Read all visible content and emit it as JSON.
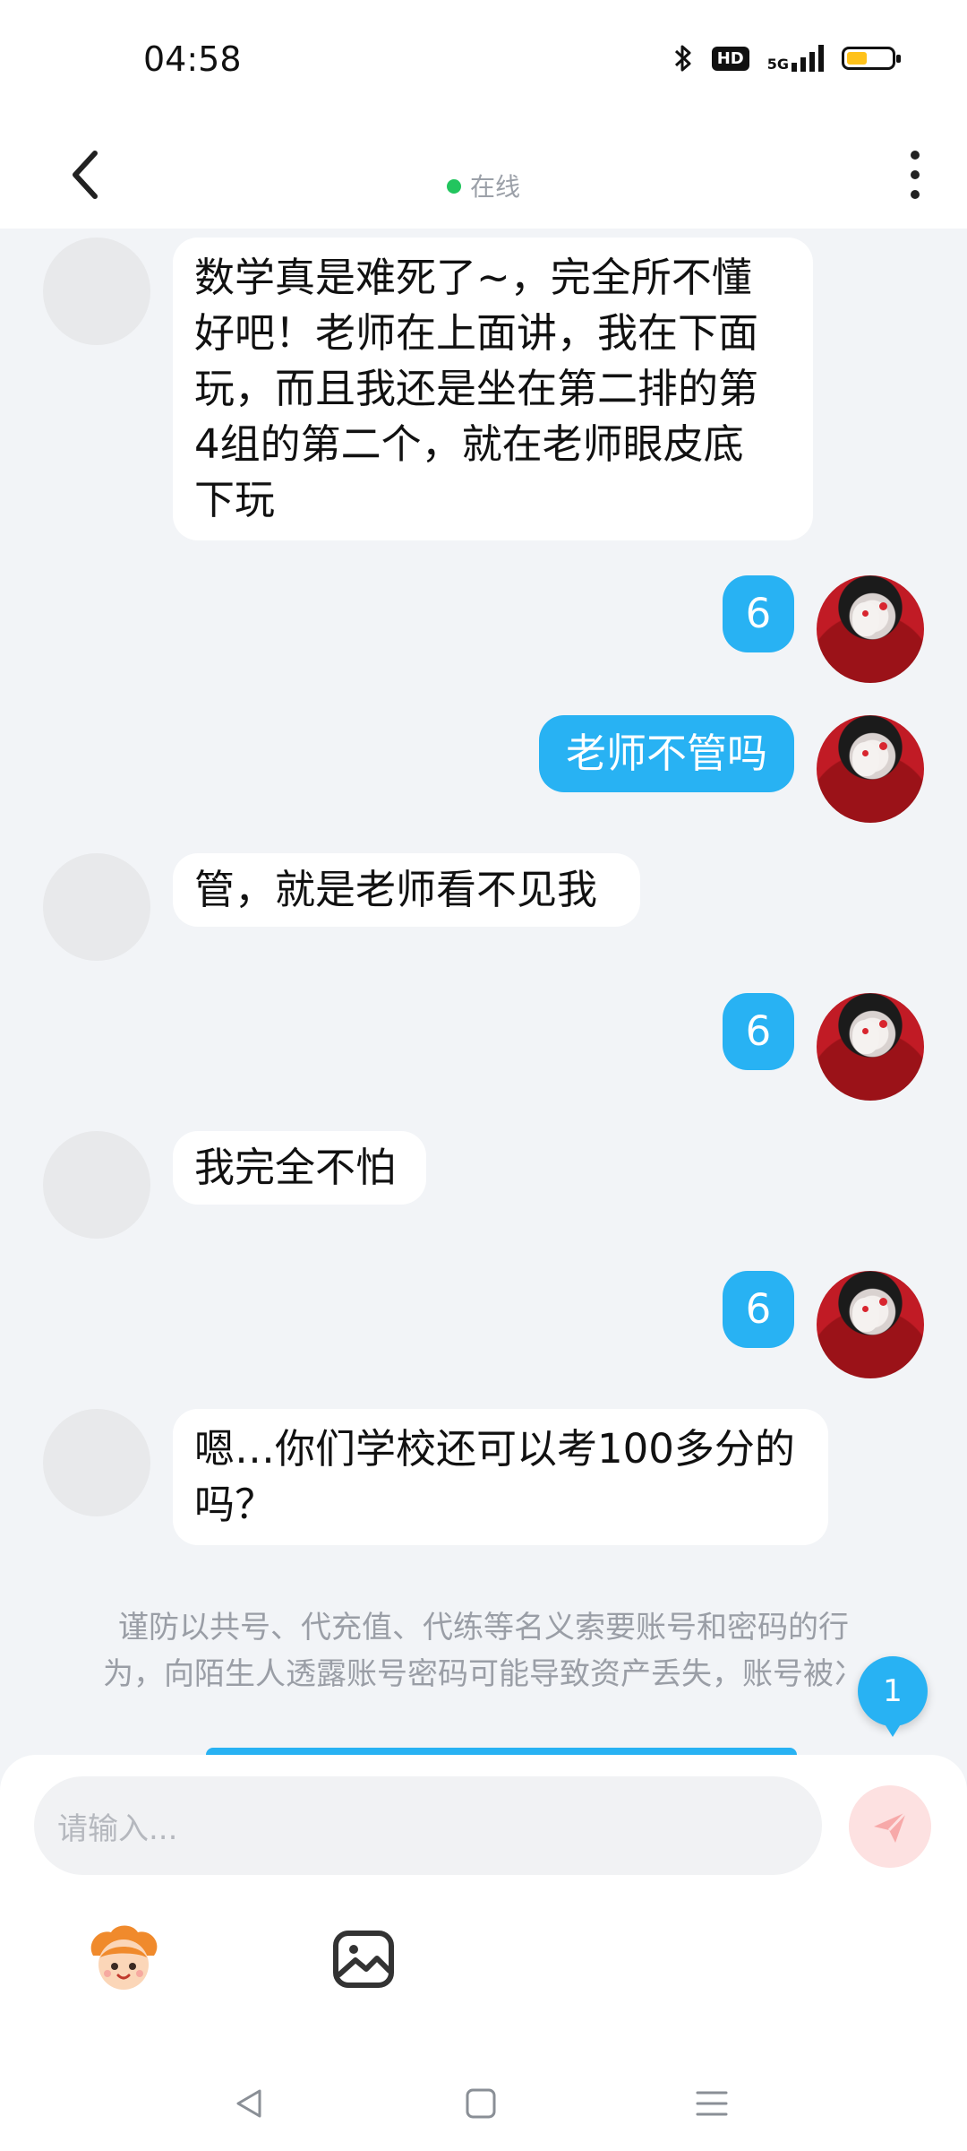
{
  "status_bar": {
    "time": "04:58",
    "hd_label": "HD",
    "network": "5G"
  },
  "header": {
    "presence": "在线"
  },
  "messages": [
    {
      "side": "left",
      "text_lines": [
        "数学真是难死了~，完全所不懂",
        "好吧！老师在上面讲，我在下面",
        "玩，而且我还是坐在第二排的第",
        "4组的第二个，就在老师眼皮底",
        "下玩"
      ]
    },
    {
      "side": "right",
      "text": "6"
    },
    {
      "side": "right",
      "text": "老师不管吗"
    },
    {
      "side": "left",
      "text_lines": [
        "管，就是老师看不见我"
      ]
    },
    {
      "side": "right",
      "text": "6"
    },
    {
      "side": "left",
      "text_lines": [
        "我完全不怕"
      ]
    },
    {
      "side": "right",
      "text": "6"
    },
    {
      "side": "left",
      "text_lines": [
        "嗯…你们学校还可以考100多分的",
        "吗？"
      ]
    }
  ],
  "notice": {
    "line1": "谨防以共号、代充值、代练等名义索要账号和密码的行",
    "line2": "为，向陌生人透露账号密码可能导致资产丢失，账号被冫"
  },
  "unread_badge": "1",
  "input": {
    "placeholder": "请输入..."
  },
  "colors": {
    "accent": "#28b2f3",
    "background": "#f2f4f7",
    "online": "#22c55e",
    "send_disabled": "#fde1e1"
  },
  "icons": [
    "bluetooth-icon",
    "hd-icon",
    "signal-icon",
    "battery-icon",
    "back-arrow-icon",
    "more-vertical-icon",
    "send-icon",
    "emoji-mascot-icon",
    "image-icon",
    "nav-back-icon",
    "nav-home-icon",
    "nav-menu-icon"
  ]
}
